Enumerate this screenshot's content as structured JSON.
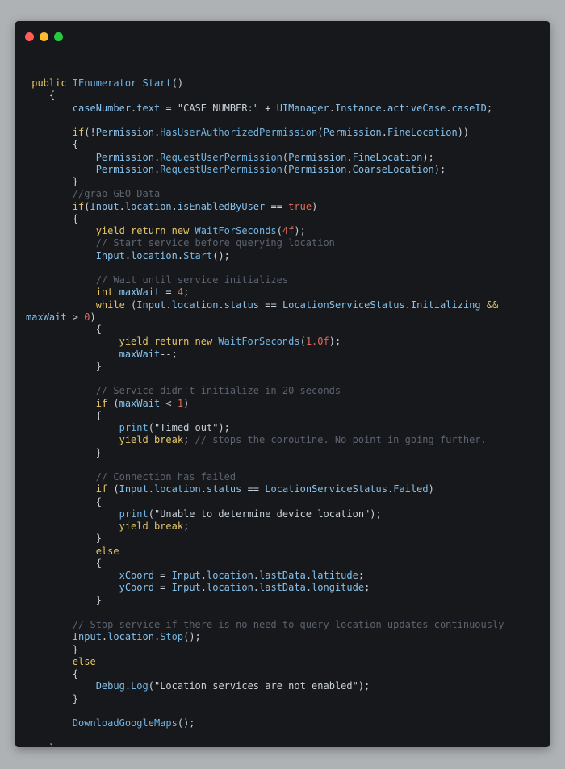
{
  "window": {
    "controls": {
      "close_color": "#ff5f57",
      "minimize_color": "#febc2e",
      "zoom_color": "#28c840"
    }
  },
  "code": {
    "lines": [
      [
        {
          "t": " public ",
          "c": "kw"
        },
        {
          "t": "IEnumerator ",
          "c": "ty"
        },
        {
          "t": "Start",
          "c": "fn"
        },
        {
          "t": "()",
          "c": "pn"
        }
      ],
      [
        {
          "t": "    {",
          "c": "pn"
        }
      ],
      [
        {
          "t": "        caseNumber",
          "c": "id"
        },
        {
          "t": ".",
          "c": "pn"
        },
        {
          "t": "text",
          "c": "id"
        },
        {
          "t": " = ",
          "c": "pn"
        },
        {
          "t": "\"CASE NUMBER:\"",
          "c": "str"
        },
        {
          "t": " + ",
          "c": "pn"
        },
        {
          "t": "UIManager",
          "c": "id"
        },
        {
          "t": ".",
          "c": "pn"
        },
        {
          "t": "Instance",
          "c": "id"
        },
        {
          "t": ".",
          "c": "pn"
        },
        {
          "t": "activeCase",
          "c": "id"
        },
        {
          "t": ".",
          "c": "pn"
        },
        {
          "t": "caseID",
          "c": "id"
        },
        {
          "t": ";",
          "c": "pn"
        }
      ],
      [],
      [
        {
          "t": "        if",
          "c": "kw"
        },
        {
          "t": "(!",
          "c": "pn"
        },
        {
          "t": "Permission",
          "c": "id"
        },
        {
          "t": ".",
          "c": "pn"
        },
        {
          "t": "HasUserAuthorizedPermission",
          "c": "fn"
        },
        {
          "t": "(",
          "c": "pn"
        },
        {
          "t": "Permission",
          "c": "id"
        },
        {
          "t": ".",
          "c": "pn"
        },
        {
          "t": "FineLocation",
          "c": "id"
        },
        {
          "t": "))",
          "c": "pn"
        }
      ],
      [
        {
          "t": "        {",
          "c": "pn"
        }
      ],
      [
        {
          "t": "            Permission",
          "c": "id"
        },
        {
          "t": ".",
          "c": "pn"
        },
        {
          "t": "RequestUserPermission",
          "c": "fn"
        },
        {
          "t": "(",
          "c": "pn"
        },
        {
          "t": "Permission",
          "c": "id"
        },
        {
          "t": ".",
          "c": "pn"
        },
        {
          "t": "FineLocation",
          "c": "id"
        },
        {
          "t": ");",
          "c": "pn"
        }
      ],
      [
        {
          "t": "            Permission",
          "c": "id"
        },
        {
          "t": ".",
          "c": "pn"
        },
        {
          "t": "RequestUserPermission",
          "c": "fn"
        },
        {
          "t": "(",
          "c": "pn"
        },
        {
          "t": "Permission",
          "c": "id"
        },
        {
          "t": ".",
          "c": "pn"
        },
        {
          "t": "CoarseLocation",
          "c": "id"
        },
        {
          "t": ");",
          "c": "pn"
        }
      ],
      [
        {
          "t": "        }",
          "c": "pn"
        }
      ],
      [
        {
          "t": "        //grab GEO Data",
          "c": "cm"
        }
      ],
      [
        {
          "t": "        if",
          "c": "kw"
        },
        {
          "t": "(",
          "c": "pn"
        },
        {
          "t": "Input",
          "c": "id"
        },
        {
          "t": ".",
          "c": "pn"
        },
        {
          "t": "location",
          "c": "id"
        },
        {
          "t": ".",
          "c": "pn"
        },
        {
          "t": "isEnabledByUser",
          "c": "id"
        },
        {
          "t": " == ",
          "c": "pn"
        },
        {
          "t": "true",
          "c": "tr"
        },
        {
          "t": ")",
          "c": "pn"
        }
      ],
      [
        {
          "t": "        {",
          "c": "pn"
        }
      ],
      [
        {
          "t": "            yield return new ",
          "c": "kw"
        },
        {
          "t": "WaitForSeconds",
          "c": "fn"
        },
        {
          "t": "(",
          "c": "pn"
        },
        {
          "t": "4f",
          "c": "num"
        },
        {
          "t": ");",
          "c": "pn"
        }
      ],
      [
        {
          "t": "            // Start service before querying location",
          "c": "cm"
        }
      ],
      [
        {
          "t": "            Input",
          "c": "id"
        },
        {
          "t": ".",
          "c": "pn"
        },
        {
          "t": "location",
          "c": "id"
        },
        {
          "t": ".",
          "c": "pn"
        },
        {
          "t": "Start",
          "c": "fn"
        },
        {
          "t": "();",
          "c": "pn"
        }
      ],
      [],
      [
        {
          "t": "            // Wait until service initializes",
          "c": "cm"
        }
      ],
      [
        {
          "t": "            int ",
          "c": "kw"
        },
        {
          "t": "maxWait",
          "c": "id"
        },
        {
          "t": " = ",
          "c": "pn"
        },
        {
          "t": "4",
          "c": "num"
        },
        {
          "t": ";",
          "c": "pn"
        }
      ],
      [
        {
          "t": "            while ",
          "c": "kw"
        },
        {
          "t": "(",
          "c": "pn"
        },
        {
          "t": "Input",
          "c": "id"
        },
        {
          "t": ".",
          "c": "pn"
        },
        {
          "t": "location",
          "c": "id"
        },
        {
          "t": ".",
          "c": "pn"
        },
        {
          "t": "status",
          "c": "id"
        },
        {
          "t": " == ",
          "c": "pn"
        },
        {
          "t": "LocationServiceStatus",
          "c": "id"
        },
        {
          "t": ".",
          "c": "pn"
        },
        {
          "t": "Initializing",
          "c": "id"
        },
        {
          "t": " &&",
          "c": "kw"
        }
      ],
      [
        {
          "t": "maxWait",
          "c": "id"
        },
        {
          "t": " > ",
          "c": "pn"
        },
        {
          "t": "0",
          "c": "num"
        },
        {
          "t": ")",
          "c": "pn"
        }
      ],
      [
        {
          "t": "            {",
          "c": "pn"
        }
      ],
      [
        {
          "t": "                yield return new ",
          "c": "kw"
        },
        {
          "t": "WaitForSeconds",
          "c": "fn"
        },
        {
          "t": "(",
          "c": "pn"
        },
        {
          "t": "1.0f",
          "c": "num"
        },
        {
          "t": ");",
          "c": "pn"
        }
      ],
      [
        {
          "t": "                maxWait",
          "c": "id"
        },
        {
          "t": "--;",
          "c": "pn"
        }
      ],
      [
        {
          "t": "            }",
          "c": "pn"
        }
      ],
      [],
      [
        {
          "t": "            // Service didn't initialize in 20 seconds",
          "c": "cm"
        }
      ],
      [
        {
          "t": "            if ",
          "c": "kw"
        },
        {
          "t": "(",
          "c": "pn"
        },
        {
          "t": "maxWait",
          "c": "id"
        },
        {
          "t": " < ",
          "c": "pn"
        },
        {
          "t": "1",
          "c": "num"
        },
        {
          "t": ")",
          "c": "pn"
        }
      ],
      [
        {
          "t": "            {",
          "c": "pn"
        }
      ],
      [
        {
          "t": "                print",
          "c": "fn"
        },
        {
          "t": "(",
          "c": "pn"
        },
        {
          "t": "\"Timed out\"",
          "c": "str"
        },
        {
          "t": ");",
          "c": "pn"
        }
      ],
      [
        {
          "t": "                yield break",
          "c": "kw"
        },
        {
          "t": "; ",
          "c": "pn"
        },
        {
          "t": "// stops the coroutine. No point in going further.",
          "c": "cm"
        }
      ],
      [
        {
          "t": "            }",
          "c": "pn"
        }
      ],
      [],
      [
        {
          "t": "            // Connection has failed",
          "c": "cm"
        }
      ],
      [
        {
          "t": "            if ",
          "c": "kw"
        },
        {
          "t": "(",
          "c": "pn"
        },
        {
          "t": "Input",
          "c": "id"
        },
        {
          "t": ".",
          "c": "pn"
        },
        {
          "t": "location",
          "c": "id"
        },
        {
          "t": ".",
          "c": "pn"
        },
        {
          "t": "status",
          "c": "id"
        },
        {
          "t": " == ",
          "c": "pn"
        },
        {
          "t": "LocationServiceStatus",
          "c": "id"
        },
        {
          "t": ".",
          "c": "pn"
        },
        {
          "t": "Failed",
          "c": "id"
        },
        {
          "t": ")",
          "c": "pn"
        }
      ],
      [
        {
          "t": "            {",
          "c": "pn"
        }
      ],
      [
        {
          "t": "                print",
          "c": "fn"
        },
        {
          "t": "(",
          "c": "pn"
        },
        {
          "t": "\"Unable to determine device location\"",
          "c": "str"
        },
        {
          "t": ");",
          "c": "pn"
        }
      ],
      [
        {
          "t": "                yield break",
          "c": "kw"
        },
        {
          "t": ";",
          "c": "pn"
        }
      ],
      [
        {
          "t": "            }",
          "c": "pn"
        }
      ],
      [
        {
          "t": "            else",
          "c": "kw"
        }
      ],
      [
        {
          "t": "            {",
          "c": "pn"
        }
      ],
      [
        {
          "t": "                xCoord",
          "c": "id"
        },
        {
          "t": " = ",
          "c": "pn"
        },
        {
          "t": "Input",
          "c": "id"
        },
        {
          "t": ".",
          "c": "pn"
        },
        {
          "t": "location",
          "c": "id"
        },
        {
          "t": ".",
          "c": "pn"
        },
        {
          "t": "lastData",
          "c": "id"
        },
        {
          "t": ".",
          "c": "pn"
        },
        {
          "t": "latitude",
          "c": "id"
        },
        {
          "t": ";",
          "c": "pn"
        }
      ],
      [
        {
          "t": "                yCoord",
          "c": "id"
        },
        {
          "t": " = ",
          "c": "pn"
        },
        {
          "t": "Input",
          "c": "id"
        },
        {
          "t": ".",
          "c": "pn"
        },
        {
          "t": "location",
          "c": "id"
        },
        {
          "t": ".",
          "c": "pn"
        },
        {
          "t": "lastData",
          "c": "id"
        },
        {
          "t": ".",
          "c": "pn"
        },
        {
          "t": "longitude",
          "c": "id"
        },
        {
          "t": ";",
          "c": "pn"
        }
      ],
      [
        {
          "t": "            }",
          "c": "pn"
        }
      ],
      [],
      [
        {
          "t": "        // Stop service if there is no need to query location updates continuously",
          "c": "cm"
        }
      ],
      [
        {
          "t": "        Input",
          "c": "id"
        },
        {
          "t": ".",
          "c": "pn"
        },
        {
          "t": "location",
          "c": "id"
        },
        {
          "t": ".",
          "c": "pn"
        },
        {
          "t": "Stop",
          "c": "fn"
        },
        {
          "t": "();",
          "c": "pn"
        }
      ],
      [
        {
          "t": "        }",
          "c": "pn"
        }
      ],
      [
        {
          "t": "        else",
          "c": "kw"
        }
      ],
      [
        {
          "t": "        {",
          "c": "pn"
        }
      ],
      [
        {
          "t": "            Debug",
          "c": "id"
        },
        {
          "t": ".",
          "c": "pn"
        },
        {
          "t": "Log",
          "c": "fn"
        },
        {
          "t": "(",
          "c": "pn"
        },
        {
          "t": "\"Location services are not enabled\"",
          "c": "str"
        },
        {
          "t": ");",
          "c": "pn"
        }
      ],
      [
        {
          "t": "        }",
          "c": "pn"
        }
      ],
      [],
      [
        {
          "t": "        DownloadGoogleMaps",
          "c": "fn"
        },
        {
          "t": "();",
          "c": "pn"
        }
      ],
      [],
      [
        {
          "t": "    }",
          "c": "pn"
        }
      ]
    ]
  }
}
